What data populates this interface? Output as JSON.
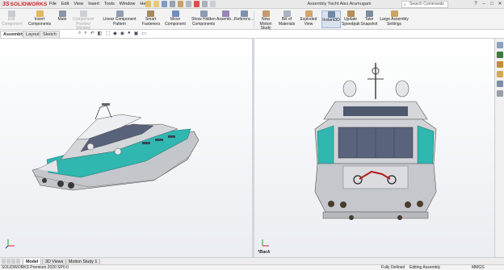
{
  "app": {
    "logo_prefix": "3S",
    "logo_text": "SOLIDWORKS"
  },
  "menu": [
    "File",
    "Edit",
    "View",
    "Insert",
    "Tools",
    "Window",
    "Help"
  ],
  "document_title": "Assembly Yacht Alex Arumugam",
  "search": {
    "placeholder": "Search Commands"
  },
  "window_controls": [
    "?",
    "–",
    "□",
    "✕"
  ],
  "command_manager": {
    "edit_component": "Edit\nComponent",
    "insert_components": "Insert Components",
    "mate": "Mate",
    "component_preview": "Component\nPreview Window",
    "linear_pattern": "Linear Component Pattern",
    "smart_fasteners": "Smart\nFasteners",
    "move_component": "Move Component",
    "show_hidden": "Show Hidden\nComponents",
    "assembly_features": "Assemb...",
    "reference_geometry": "Referenc...",
    "new_motion_study": "New Motion\nStudy",
    "bill_of_materials": "Bill of\nMaterials",
    "exploded_view": "Exploded View",
    "instant3d": "Instant3D",
    "update_speedpak": "Update\nSpeedpak",
    "take_snapshot": "Take\nSnapshot",
    "large_assembly": "Large Assembly\nSettings"
  },
  "tabs": [
    {
      "label": "Assembly",
      "active": true
    },
    {
      "label": "Layout",
      "active": false
    },
    {
      "label": "Sketch",
      "active": false
    }
  ],
  "viewports": {
    "right_view_label": "*Back"
  },
  "bottom_tabs": [
    {
      "label": "Model",
      "active": true
    },
    {
      "label": "3D Views",
      "active": false
    },
    {
      "label": "Motion Study 1",
      "active": false
    }
  ],
  "status": {
    "product": "SOLIDWORKS Premium 2020 SP0.0",
    "definition": "Fully Defined",
    "mode": "Editing Assembly",
    "units": "MMGS"
  },
  "colors": {
    "accent_teal": "#2fb7b0",
    "hull_gray": "#b9bcc1",
    "brand_red": "#d2232a"
  }
}
